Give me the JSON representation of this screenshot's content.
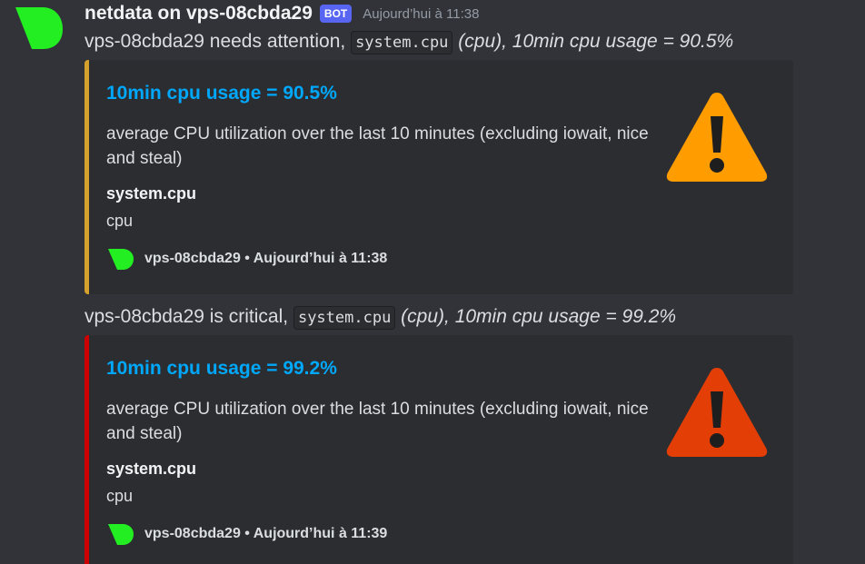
{
  "author": {
    "name": "netdata on vps-08cbda29",
    "badge": "BOT",
    "timestamp": "Aujourd’hui à 11:38"
  },
  "colors": {
    "avatar": "#22ee22",
    "warning_bar": "#d4a22c",
    "critical_bar": "#cc0000",
    "warning_icon": "#ff9c00",
    "critical_icon": "#e23e06",
    "title_link": "#00a8fc"
  },
  "messages": [
    {
      "severity": "warning",
      "content": {
        "prefix": "vps-08cbda29 needs attention,",
        "code": "system.cpu",
        "paren": "(cpu),",
        "metric": "10min cpu usage = 90.5%"
      },
      "embed": {
        "title": "10min cpu usage = 90.5%",
        "description": "average CPU utilization over the last 10 minutes (excluding iowait, nice and steal)",
        "field_name": "system.cpu",
        "field_value": "cpu",
        "footer": "vps-08cbda29 • Aujourd’hui à 11:38",
        "icon": "warning-triangle-icon"
      }
    },
    {
      "severity": "critical",
      "content": {
        "prefix": "vps-08cbda29 is critical,",
        "code": "system.cpu",
        "paren": "(cpu),",
        "metric": "10min cpu usage = 99.2%"
      },
      "embed": {
        "title": "10min cpu usage = 99.2%",
        "description": "average CPU utilization over the last 10 minutes (excluding iowait, nice and steal)",
        "field_name": "system.cpu",
        "field_value": "cpu",
        "footer": "vps-08cbda29 • Aujourd’hui à 11:39",
        "icon": "critical-triangle-icon"
      }
    }
  ]
}
